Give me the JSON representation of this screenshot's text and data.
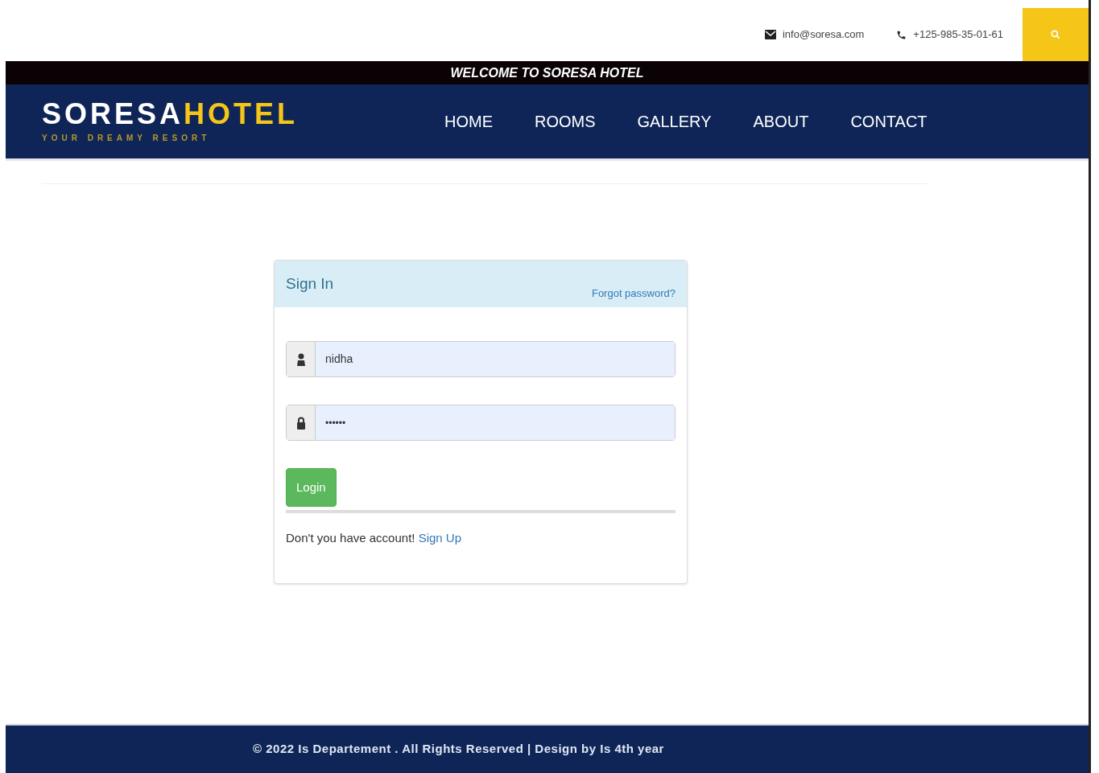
{
  "topbar": {
    "email": "info@soresa.com",
    "phone": "+125-985-35-01-61"
  },
  "welcome": "WELCOME TO SORESA HOTEL",
  "logo": {
    "part1": "SORESA",
    "part2": "HOTEL",
    "tagline": "YOUR DREAMY RESORT"
  },
  "nav": [
    {
      "label": "HOME"
    },
    {
      "label": "ROOMS"
    },
    {
      "label": "GALLERY"
    },
    {
      "label": "ABOUT"
    },
    {
      "label": "CONTACT"
    }
  ],
  "signin": {
    "title": "Sign In",
    "forgot": "Forgot password?",
    "username": "nidha",
    "password": "••••••",
    "button": "Login",
    "prompt": "Don't you have account!",
    "signup": "Sign Up"
  },
  "footer": "© 2022 Is Departement . All Rights Reserved | Design by Is 4th year"
}
